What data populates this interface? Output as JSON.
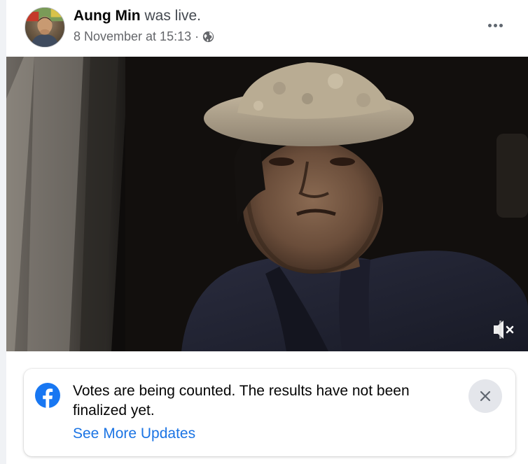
{
  "post": {
    "author_name": "Aung Min",
    "author_status": " was live.",
    "timestamp": "8 November at 15:13",
    "separator": "·",
    "privacy_icon": "globe-icon",
    "more_icon": "more-options-icon"
  },
  "video": {
    "mute_icon": "volume-muted-icon"
  },
  "notice": {
    "icon": "facebook-logo-icon",
    "message": "Votes are being counted. The results have not been finalized yet.",
    "link_label": "See More Updates",
    "close_icon": "close-icon"
  },
  "colors": {
    "link": "#1b74e4",
    "facebook_blue": "#1877f2",
    "close_bg": "#e4e6eb"
  }
}
